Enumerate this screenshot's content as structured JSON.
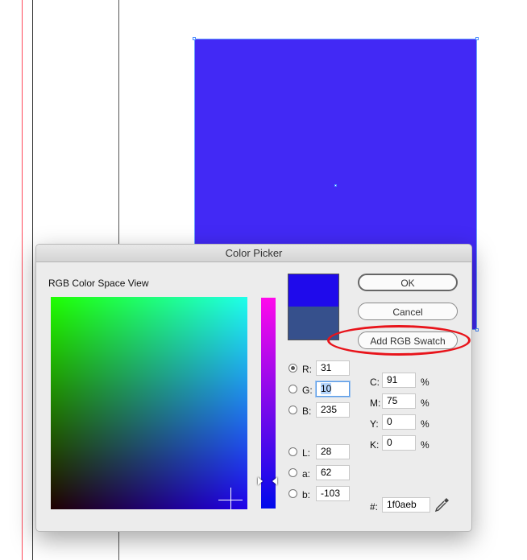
{
  "dialog": {
    "title": "Color Picker",
    "view_label": "RGB Color Space View",
    "new_color": "#1f0aeb",
    "old_color": "#36508c",
    "buttons": {
      "ok": "OK",
      "cancel": "Cancel",
      "add_swatch": "Add RGB Swatch"
    },
    "rgb": [
      {
        "label": "R:",
        "value": "31",
        "selected": true
      },
      {
        "label": "G:",
        "value": "10",
        "selected": false
      },
      {
        "label": "B:",
        "value": "235",
        "selected": false
      }
    ],
    "lab": [
      {
        "label": "L:",
        "value": "28"
      },
      {
        "label": "a:",
        "value": "62"
      },
      {
        "label": "b:",
        "value": "-103"
      }
    ],
    "cmyk": [
      {
        "label": "C:",
        "value": "91",
        "unit": "%"
      },
      {
        "label": "M:",
        "value": "75",
        "unit": "%"
      },
      {
        "label": "Y:",
        "value": "0",
        "unit": "%"
      },
      {
        "label": "K:",
        "value": "0",
        "unit": "%"
      }
    ],
    "hex_label": "#:",
    "hex_value": "1f0aeb"
  },
  "canvas": {
    "fill_color": "#4229f5"
  },
  "annotation_color": "#e8141b"
}
